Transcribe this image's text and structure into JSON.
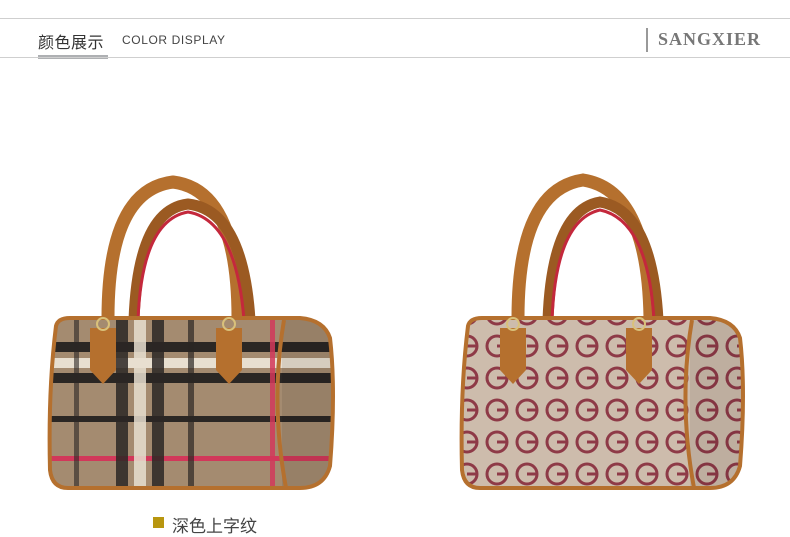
{
  "header": {
    "title_cn": "颜色展示",
    "title_en": "COLOR DISPLAY",
    "brand": "SANGXIER"
  },
  "products": [
    {
      "name": "plaid-handbag",
      "caption": "深色上字纹",
      "swatch_color": "#b8960f"
    },
    {
      "name": "monogram-handbag",
      "caption": ""
    }
  ],
  "colors": {
    "leather": "#b5702e",
    "plaid_base": "#a48b70",
    "monogram_base": "#cdbcac",
    "monogram_pattern": "#8e3a47"
  }
}
